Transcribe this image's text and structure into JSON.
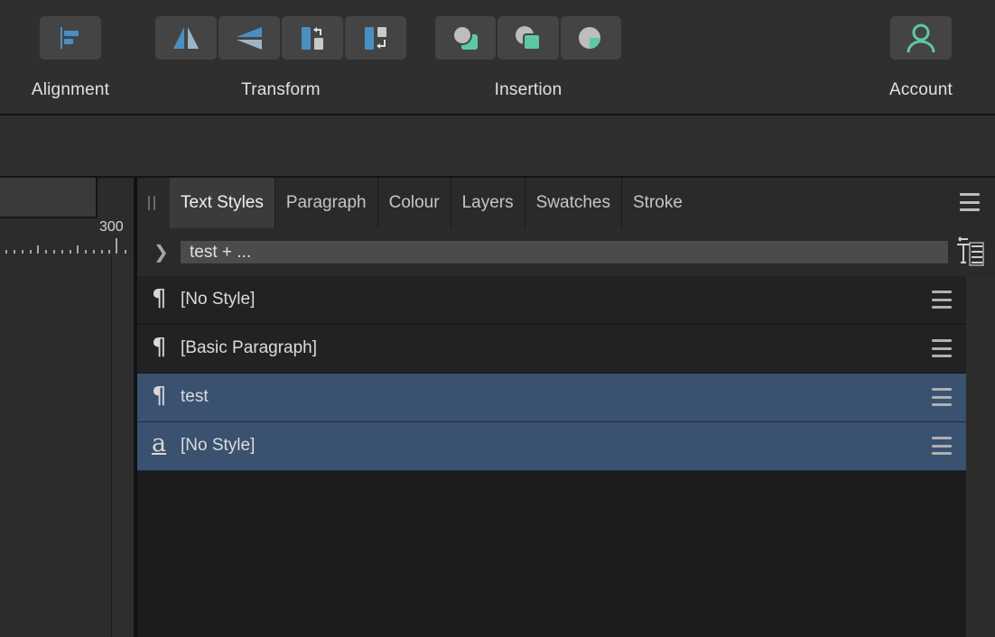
{
  "toolbar": {
    "groups": [
      {
        "label": "Alignment",
        "buttons": [
          "align-left-icon"
        ]
      },
      {
        "label": "Transform",
        "buttons": [
          "flip-horizontal-icon",
          "flip-vertical-icon",
          "rotate-left-icon",
          "rotate-right-icon"
        ]
      },
      {
        "label": "Insertion",
        "buttons": [
          "insert-behind-icon",
          "insert-top-icon",
          "insert-inside-icon"
        ]
      },
      {
        "label": "Account",
        "buttons": [
          "user-icon"
        ]
      }
    ]
  },
  "ruler": {
    "label": "300"
  },
  "panel": {
    "tabs": [
      {
        "label": "Text Styles",
        "active": true
      },
      {
        "label": "Paragraph"
      },
      {
        "label": "Colour"
      },
      {
        "label": "Layers"
      },
      {
        "label": "Swatches"
      },
      {
        "label": "Stroke"
      }
    ],
    "filter_value": "test + ...",
    "styles": [
      {
        "type": "paragraph",
        "glyph": "¶",
        "name": "[No Style]",
        "selected": false
      },
      {
        "type": "paragraph",
        "glyph": "¶",
        "name": "[Basic Paragraph]",
        "selected": false
      },
      {
        "type": "paragraph",
        "glyph": "¶",
        "name": "test",
        "selected": true
      },
      {
        "type": "character",
        "glyph": "a",
        "name": "[No Style]",
        "selected": true
      }
    ]
  },
  "colors": {
    "accent_blue": "#4a8fc4",
    "accent_green": "#5ec9a0",
    "selected_row": "#3a5170"
  }
}
